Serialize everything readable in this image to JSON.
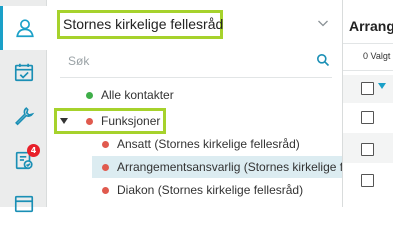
{
  "sidebar": {
    "items": [
      {
        "icon": "user-icon",
        "active": true
      },
      {
        "icon": "calendar-check-icon",
        "active": false
      },
      {
        "icon": "wrench-icon",
        "active": false
      },
      {
        "icon": "checklist-icon",
        "active": false,
        "badge": "4"
      },
      {
        "icon": "window-icon",
        "active": false
      }
    ]
  },
  "panel": {
    "org_select": "Stornes kirkelige fellesråd",
    "search_placeholder": "Søk",
    "tree": [
      {
        "label": "Alle kontakter",
        "dot": "green"
      },
      {
        "label": "Funksjoner",
        "dot": "red",
        "expanded": true
      },
      {
        "label": "Ansatt (Stornes kirkelige fellesråd)",
        "dot": "red"
      },
      {
        "label": "Arrangementsansvarlig (Stornes kirkelige fellesråd)",
        "dot": "red",
        "selected": true
      },
      {
        "label": "Diakon (Stornes kirkelige fellesråd)",
        "dot": "red"
      }
    ]
  },
  "right": {
    "title": "Arrangementsansvarlig",
    "selected_count": "0 Valgt"
  },
  "colors": {
    "accent": "#1aa0c8",
    "highlight": "#a6d22c",
    "green_dot": "#3fae49",
    "red_dot": "#e05a4e",
    "badge": "#e8202a",
    "selected_row": "#dcecf1"
  }
}
